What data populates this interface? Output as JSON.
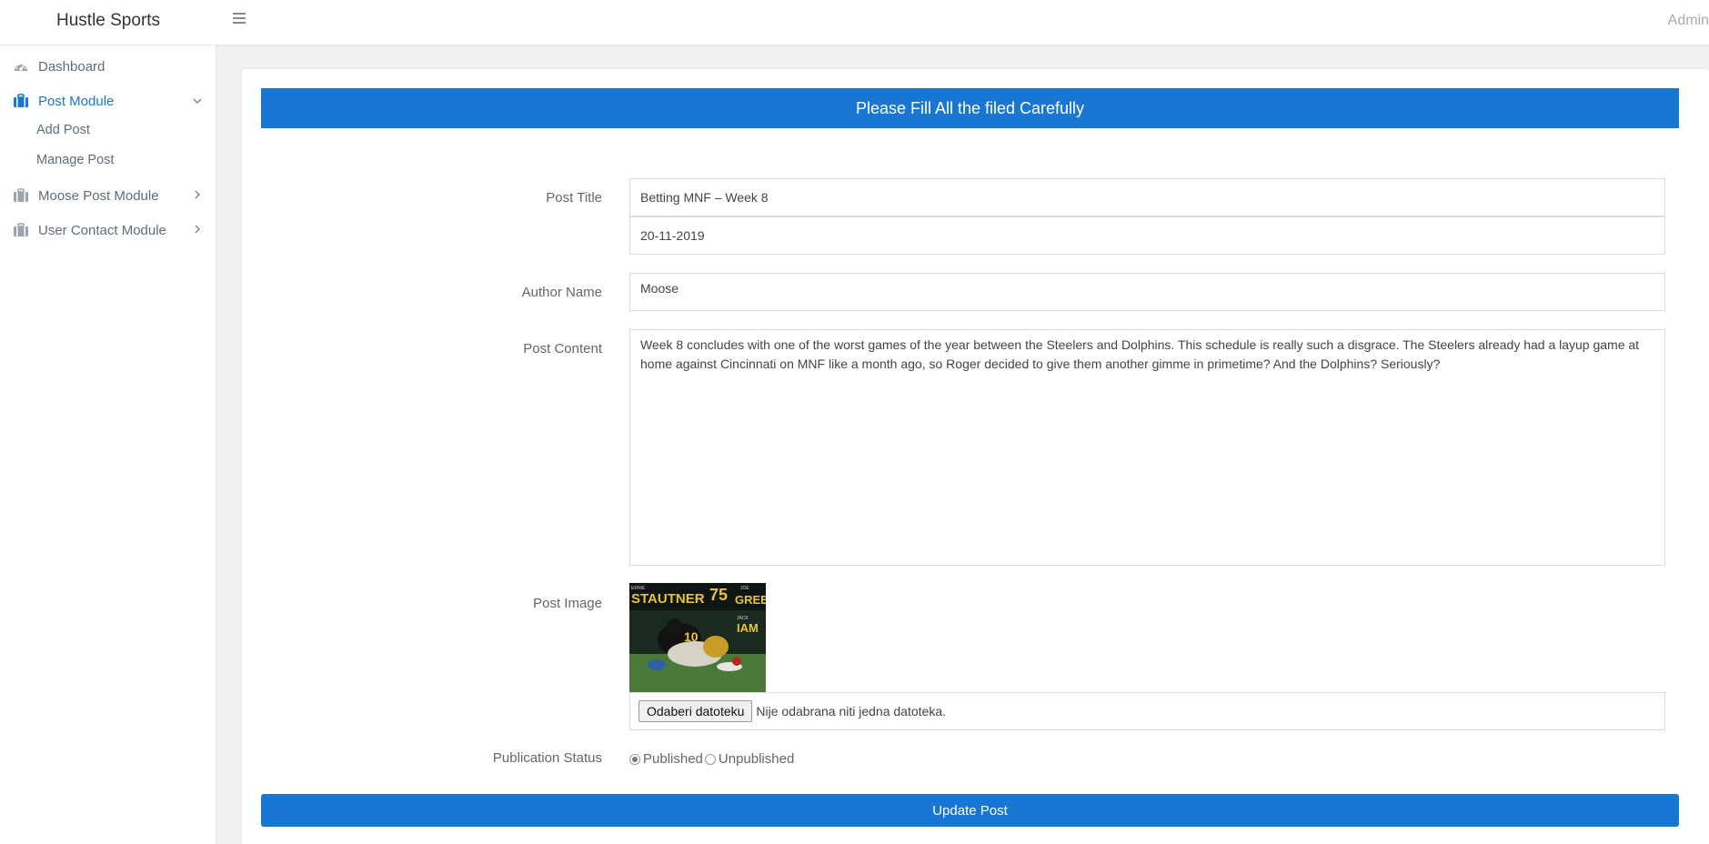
{
  "header": {
    "brand": "Hustle Sports",
    "user": "Admin"
  },
  "sidebar": {
    "items": [
      {
        "label": "Dashboard",
        "icon": "dashboard-gauge-icon"
      },
      {
        "label": "Post Module",
        "icon": "briefcase-icon",
        "expanded": true,
        "children": [
          {
            "label": "Add Post"
          },
          {
            "label": "Manage Post"
          }
        ]
      },
      {
        "label": "Moose Post Module",
        "icon": "briefcase-icon",
        "expanded": false
      },
      {
        "label": "User Contact Module",
        "icon": "briefcase-icon",
        "expanded": false
      }
    ]
  },
  "colors": {
    "accent": "#1976d2"
  },
  "form": {
    "banner": "Please Fill All the filed Carefully",
    "post_title_label": "Post Title",
    "post_title_value": "Betting MNF – Week 8",
    "date_value": "20-11-2019",
    "author_label": "Author Name",
    "author_value": "Moose",
    "content_label": "Post Content",
    "content_value": "Week 8 concludes with one of the worst games of the year between the Steelers and Dolphins. This schedule is really such a disgrace. The Steelers already had a layup game at home against Cincinnati on MNF like a month ago, so Roger decided to give them another gimme in primetime? And the Dolphins? Seriously?",
    "image_label": "Post Image",
    "file_button": "Odaberi datoteku",
    "file_status": "Nije odabrana niti jedna datoteka.",
    "status_label": "Publication Status",
    "status_options": [
      {
        "label": "Published",
        "checked": true
      },
      {
        "label": "Unpublished",
        "checked": false
      }
    ],
    "submit": "Update Post"
  },
  "image": {
    "banner_text_left": "STAUTNER",
    "banner_number": "75",
    "banner_text_right": "GREE",
    "small_left": "ERNIE",
    "small_right": "JOE",
    "lower_text": "IAM",
    "lower_small": "JACK",
    "jersey_number": "10"
  }
}
